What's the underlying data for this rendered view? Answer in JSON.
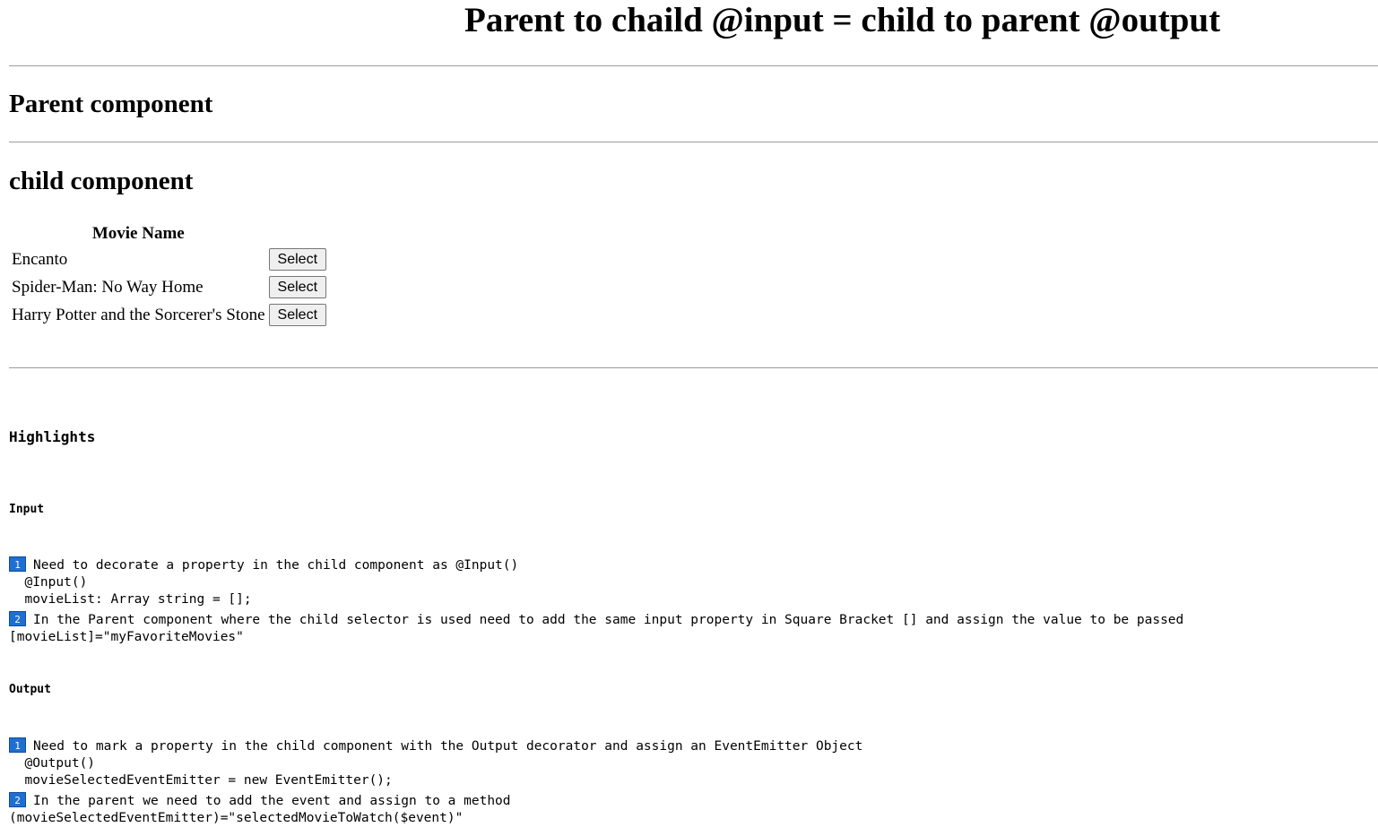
{
  "page": {
    "title": "Parent to chaild @input = child to parent @output"
  },
  "parent": {
    "heading": "Parent component"
  },
  "child": {
    "heading": "child component",
    "table": {
      "header": "Movie Name",
      "rows": [
        {
          "name": "Encanto",
          "button": "Select"
        },
        {
          "name": "Spider-Man: No Way Home",
          "button": "Select"
        },
        {
          "name": "Harry Potter and the Sorcerer's Stone",
          "button": "Select"
        }
      ]
    }
  },
  "highlights": {
    "title": "Highlights",
    "input": {
      "title": "Input",
      "step1": {
        "badge": "1",
        "text": "Need to decorate a property in the child component as @Input()",
        "code1": "  @Input()",
        "code2": "  movieList: Array string = [];"
      },
      "step2": {
        "badge": "2",
        "text": "In the Parent component where the child selector is used need to add the same input property in Square Bracket [] and assign the value to be passed",
        "code1": "[movieList]=\"myFavoriteMovies\""
      }
    },
    "output": {
      "title": "Output",
      "step1": {
        "badge": "1",
        "text": "Need to mark a property in the child component with the Output decorator and assign an EventEmitter Object",
        "code1": "  @Output()",
        "code2": "  movieSelectedEventEmitter = new EventEmitter();"
      },
      "step2": {
        "badge": "2",
        "text": "In the parent we need to add the event and assign to a method",
        "code1": "(movieSelectedEventEmitter)=\"selectedMovieToWatch($event)\""
      }
    }
  },
  "colors": {
    "badge": "#1e6fd0",
    "rule": "#9a9a9a"
  }
}
